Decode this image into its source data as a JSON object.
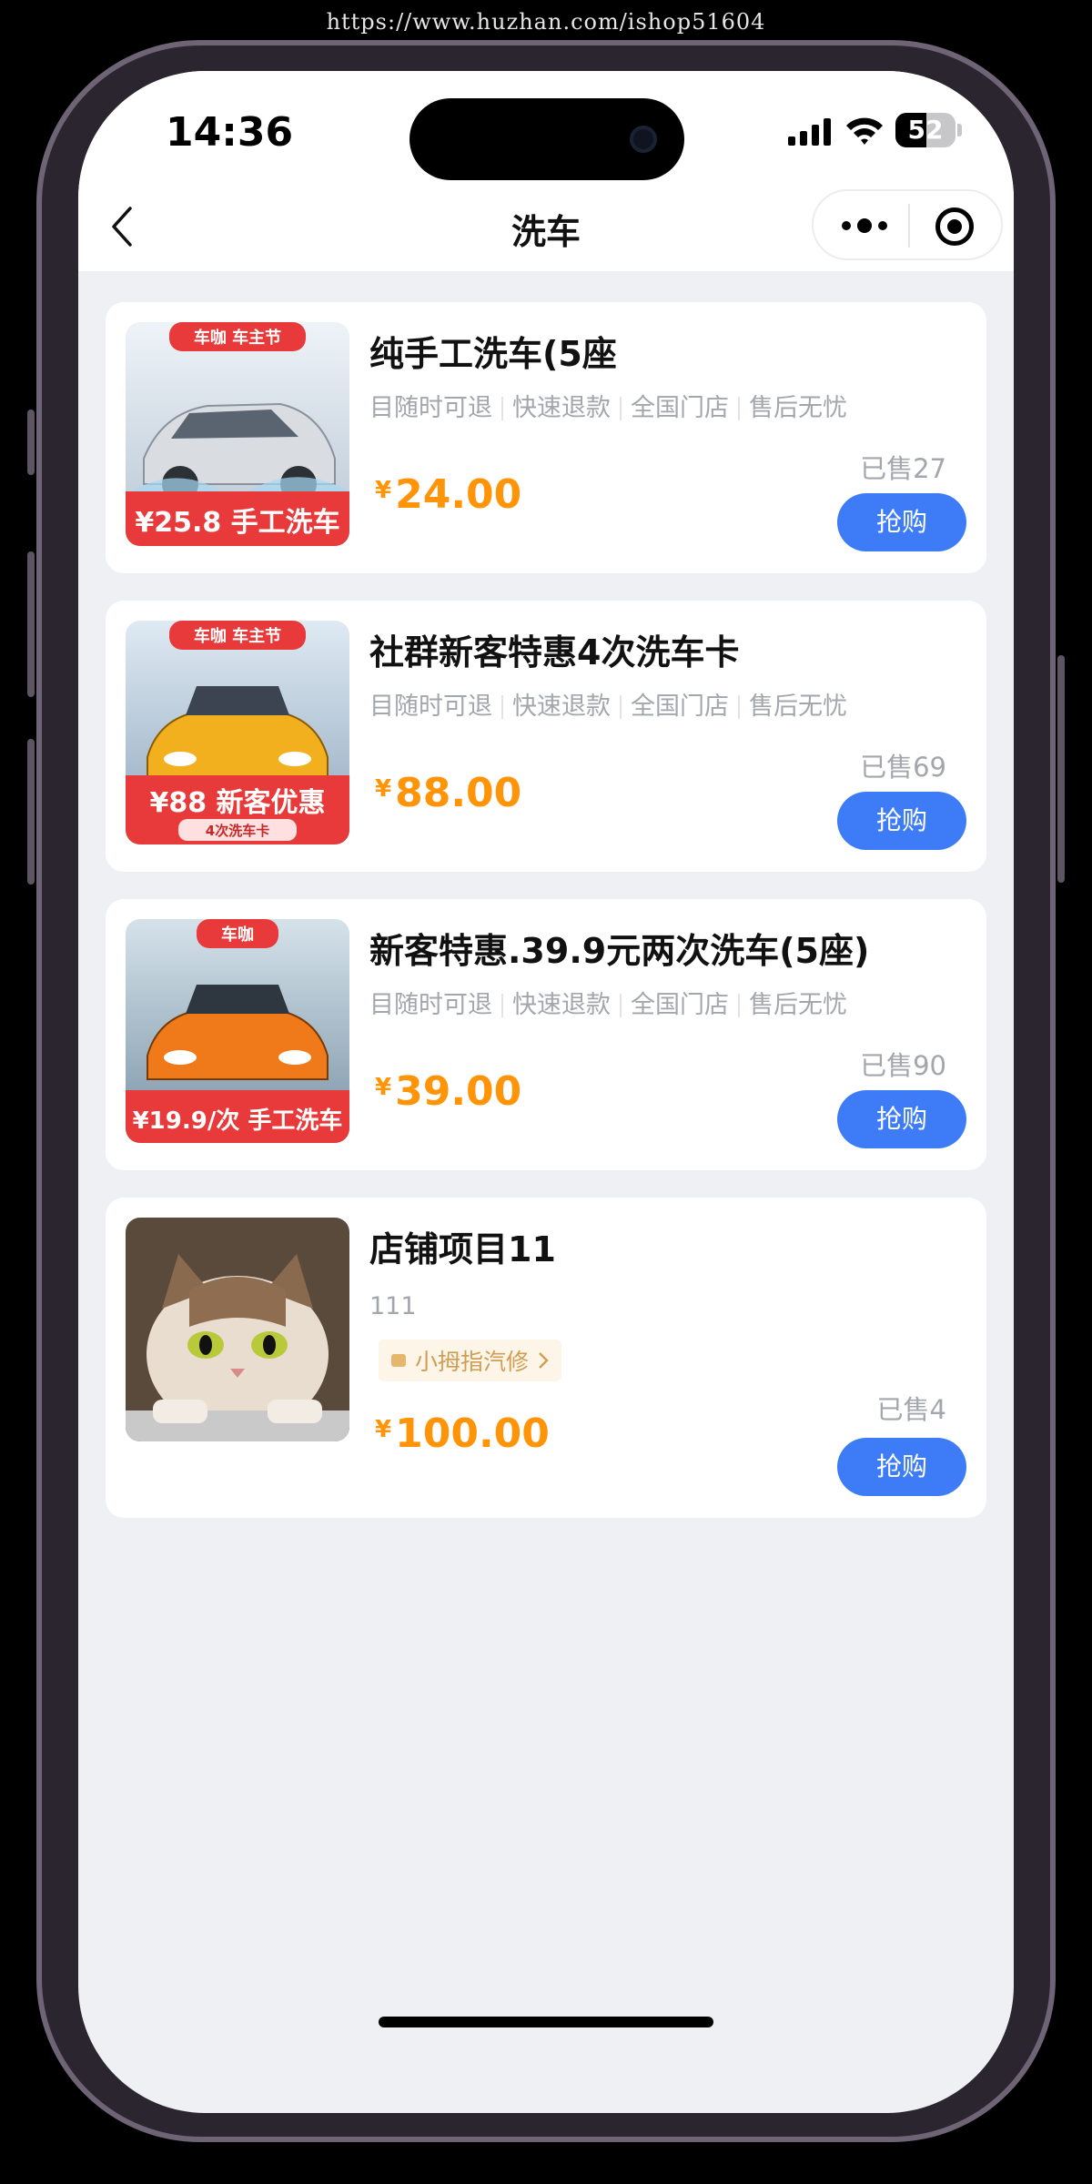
{
  "watermark": "https://www.huzhan.com/ishop51604",
  "status_bar": {
    "time": "14:36",
    "battery": "52",
    "battery_level": 0.52
  },
  "nav": {
    "title": "洗车"
  },
  "products": [
    {
      "name": "纯手工洗车(5座",
      "tags": [
        "目随时可退",
        "快速退款",
        "全国门店",
        "售后无忧"
      ],
      "currency": "¥",
      "price": "24.00",
      "sold": "已售27",
      "buy_label": "抢购",
      "thumb": {
        "badge": "车咖 车主节",
        "caption": "¥25.8 手工洗车",
        "car_color": "#d9dde2"
      }
    },
    {
      "name": "社群新客特惠4次洗车卡",
      "tags": [
        "目随时可退",
        "快速退款",
        "全国门店",
        "售后无忧"
      ],
      "currency": "¥",
      "price": "88.00",
      "sold": "已售69",
      "buy_label": "抢购",
      "thumb": {
        "badge": "车咖 车主节",
        "caption": "¥88 新客优惠",
        "subcaption": "4次洗车卡",
        "car_color": "#f2b01e"
      }
    },
    {
      "name": "新客特惠.39.9元两次洗车(5座)",
      "tags": [
        "目随时可退",
        "快速退款",
        "全国门店",
        "售后无忧"
      ],
      "currency": "¥",
      "price": "39.00",
      "sold": "已售90",
      "buy_label": "抢购",
      "thumb": {
        "badge": "车咖",
        "caption": "¥19.9/次 手工洗车",
        "car_color": "#f07a1a"
      }
    },
    {
      "name": "店铺项目11",
      "subtext": "111",
      "store": "小拇指汽修",
      "currency": "¥",
      "price": "100.00",
      "sold": "已售4",
      "buy_label": "抢购"
    }
  ]
}
